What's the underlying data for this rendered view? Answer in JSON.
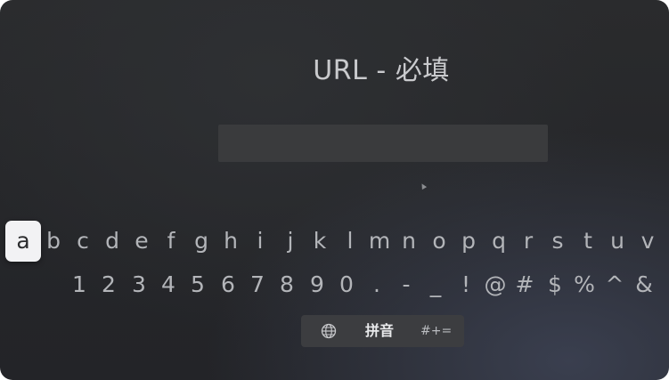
{
  "title": "URL - 必填",
  "url_field": {
    "value": "",
    "placeholder": ""
  },
  "keyboard": {
    "focused_key": "a",
    "letters": [
      "a",
      "b",
      "c",
      "d",
      "e",
      "f",
      "g",
      "h",
      "i",
      "j",
      "k",
      "l",
      "m",
      "n",
      "o",
      "p",
      "q",
      "r",
      "s",
      "t",
      "u",
      "v"
    ],
    "symbols": [
      "1",
      "2",
      "3",
      "4",
      "5",
      "6",
      "7",
      "8",
      "9",
      "0",
      ".",
      "-",
      "_",
      "!",
      "@",
      "#",
      "$",
      "%",
      "^",
      "&"
    ]
  },
  "mode_bar": {
    "globe_icon": "globe-icon",
    "input_mode_label": "拼音",
    "symbols_label": "#+="
  },
  "colors": {
    "background": "#26272a",
    "focused_key_bg": "#f2f2f4",
    "key_text": "#b3b5b9",
    "field_bg": "#3a3b3d"
  }
}
